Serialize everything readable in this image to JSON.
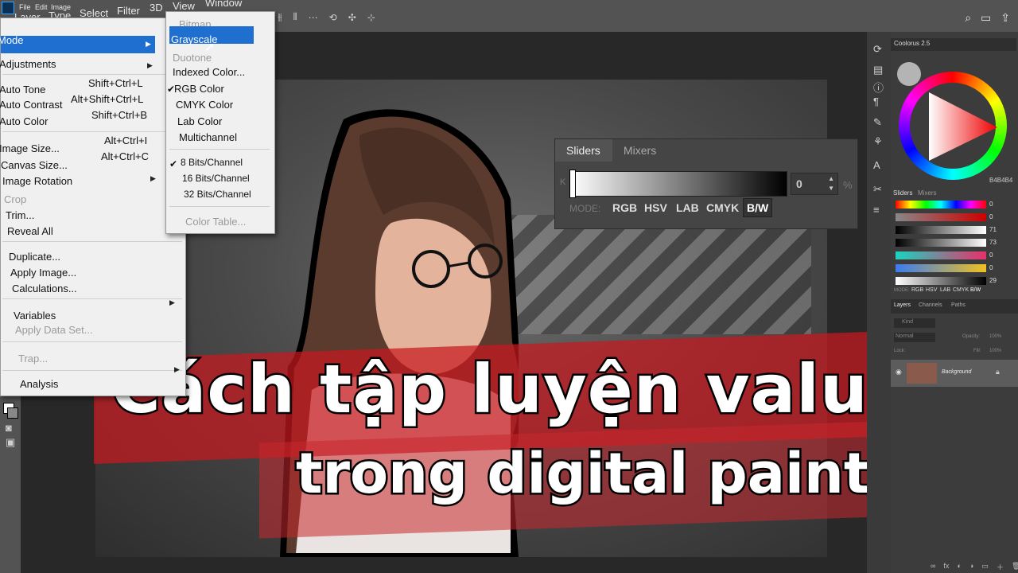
{
  "menubar": {
    "items": [
      "File",
      "Edit",
      "Image",
      "Layer",
      "Type",
      "Select",
      "Filter",
      "3D",
      "View",
      "Window"
    ]
  },
  "image_menu": {
    "mode": "Mode",
    "adjustments": "Adjustments",
    "auto_tone": "Auto Tone",
    "auto_tone_sc": "Shift+Ctrl+L",
    "auto_contrast": "Auto Contrast",
    "auto_contrast_sc": "Alt+Shift+Ctrl+L",
    "auto_color": "Auto Color",
    "auto_color_sc": "Shift+Ctrl+B",
    "image_size": "Image Size...",
    "image_size_sc": "Alt+Ctrl+I",
    "canvas_size": "Canvas Size...",
    "canvas_size_sc": "Alt+Ctrl+C",
    "image_rotation": "Image Rotation",
    "crop": "Crop",
    "trim": "Trim...",
    "reveal_all": "Reveal All",
    "duplicate": "Duplicate...",
    "apply_image": "Apply Image...",
    "calculations": "Calculations...",
    "variables": "Variables",
    "apply_data_set": "Apply Data Set...",
    "trap": "Trap...",
    "analysis": "Analysis"
  },
  "mode_menu": {
    "bitmap": "Bitmap",
    "grayscale": "Grayscale",
    "duotone": "Duotone",
    "indexed": "Indexed Color...",
    "rgb": "RGB Color",
    "cmyk": "CMYK Color",
    "lab": "Lab Color",
    "multichannel": "Multichannel",
    "bits8": "8 Bits/Channel",
    "bits16": "16 Bits/Channel",
    "bits32": "32 Bits/Channel",
    "color_table": "Color Table..."
  },
  "sliders_panel": {
    "tab_sliders": "Sliders",
    "tab_mixers": "Mixers",
    "k_label": "K",
    "value": "0",
    "unit": "%",
    "mode_label": "MODE:",
    "modes": [
      "RGB",
      "HSV",
      "LAB",
      "CMYK",
      "B/W"
    ],
    "active_mode": "B/W"
  },
  "coolorus": {
    "title": "Coolorus 2.5",
    "hex": "B4B4B4",
    "tabs": [
      "Sliders",
      "Mixers"
    ],
    "slider_values": [
      "0",
      "0",
      "71",
      "73",
      "0",
      "0",
      "29"
    ],
    "mode_label": "MODE:",
    "modes": [
      "RGB",
      "HSV",
      "LAB",
      "CMYK",
      "B/W"
    ]
  },
  "layers": {
    "tabs": [
      "Layers",
      "Channels",
      "Paths"
    ],
    "search_placeholder": "Kind",
    "blend": "Normal",
    "opacity_label": "Opacity:",
    "opacity": "100%",
    "lock_label": "Lock:",
    "fill_label": "Fill:",
    "fill": "100%",
    "layer_name": "Background"
  },
  "title": {
    "line1": "Cách tập luyện value",
    "line2": "trong digital painting"
  },
  "colors": {
    "highlight": "#1f6fd1",
    "banner": "#c8181e"
  }
}
